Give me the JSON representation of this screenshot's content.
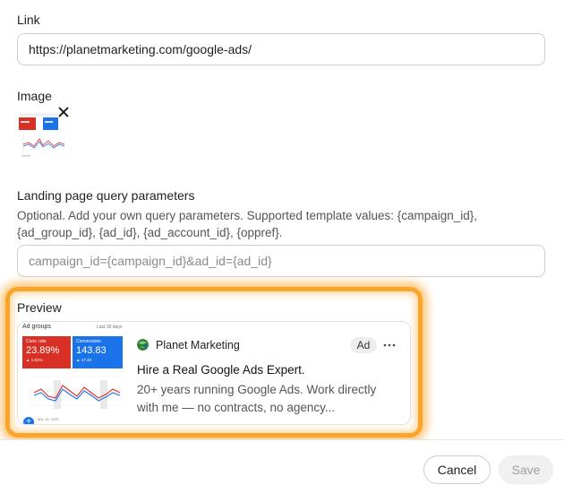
{
  "link": {
    "label": "Link",
    "value": "https://planetmarketing.com/google-ads/"
  },
  "image": {
    "label": "Image",
    "remove_icon": "close-icon"
  },
  "query_params": {
    "label": "Landing page query parameters",
    "hint": "Optional. Add your own query parameters. Supported template values: {campaign_id}, {ad_group_id}, {ad_id}, {ad_account_id}, {oppref}.",
    "placeholder": "campaign_id={campaign_id}&ad_id={ad_id}"
  },
  "preview": {
    "label": "Preview",
    "image": {
      "title": "Ad groups",
      "range": "Last 30 days",
      "tile1": {
        "label": "Conv. rate",
        "value": "23.89%",
        "delta": "▲ 1.81%",
        "color": "#d93025"
      },
      "tile2": {
        "label": "Conversions",
        "value": "143.83",
        "delta": "▲ 17.33",
        "color": "#1a73e8"
      },
      "fab": "+",
      "foot": "Mar 15, 2025"
    },
    "brand": "Planet Marketing",
    "badge": "Ad",
    "more_icon": "more-horizontal-icon",
    "headline": "Hire a Real Google Ads Expert.",
    "description": "20+ years running Google Ads. Work directly with me — no contracts, no agency..."
  },
  "actions": {
    "cancel": "Cancel",
    "save": "Save"
  },
  "colors": {
    "highlight": "#f9a52b",
    "border": "#cfcfcf"
  }
}
